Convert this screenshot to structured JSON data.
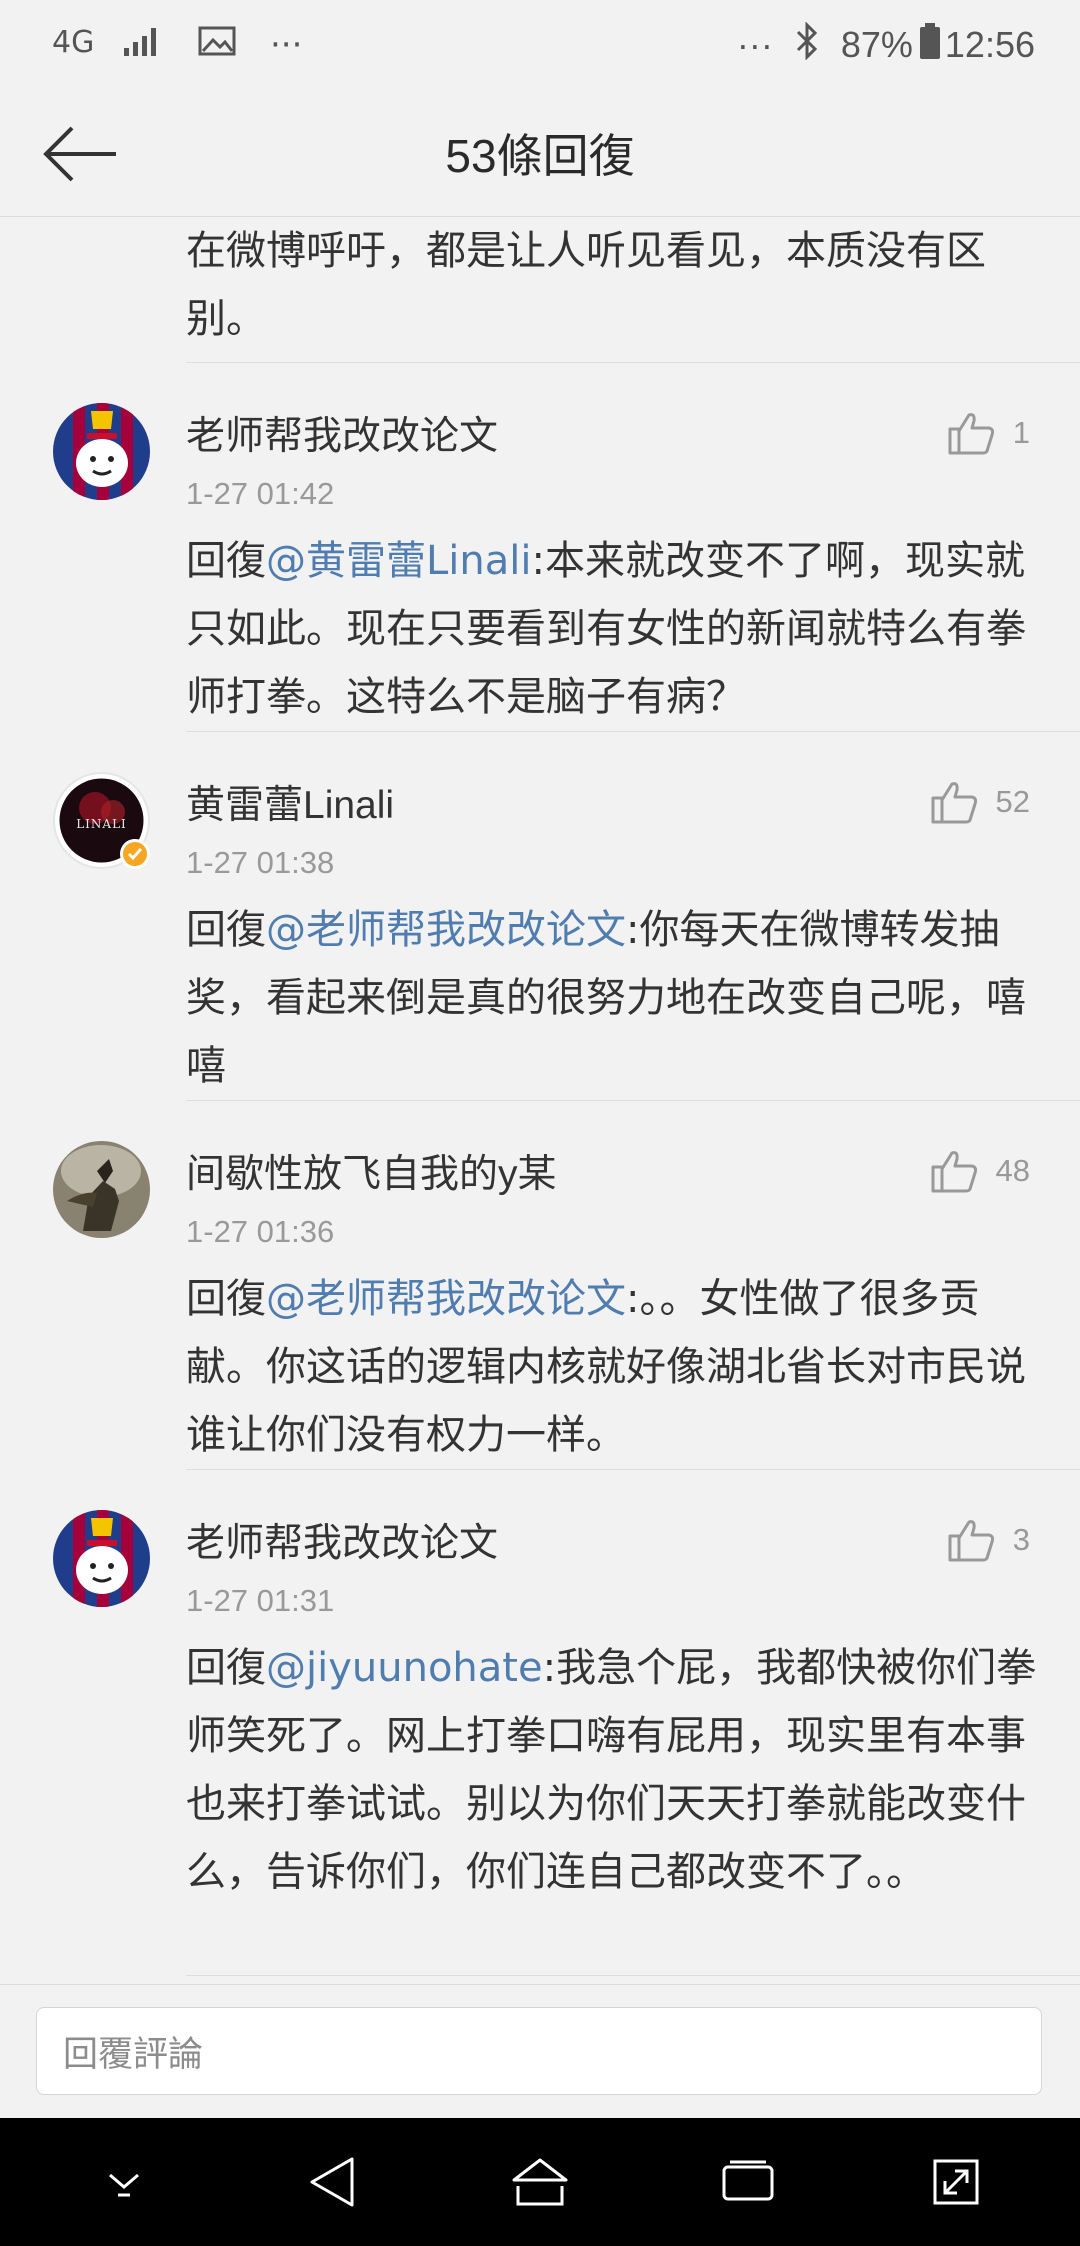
{
  "status_bar": {
    "network_label": "4G",
    "signal_icon": "signal-bars-icon",
    "image_icon": "image-icon",
    "more_icon": "ellipsis-icon",
    "more_dots": "···",
    "right_more": "···",
    "bluetooth_icon": "bluetooth-icon",
    "battery_percent": "87%",
    "battery_icon": "battery-icon",
    "time": "12:56"
  },
  "header": {
    "back_icon": "back-arrow-icon",
    "title": "53條回復"
  },
  "top_fragment": {
    "text": "在微博呼吁，都是让人听见看见，本质没有区别。"
  },
  "comments": [
    {
      "username": "老师帮我改改论文",
      "timestamp": "1-27 01:42",
      "likes": "1",
      "reply_prefix": "回復",
      "mention": "@黄雷蕾Linali",
      "text": ":本来就改变不了啊，现实就只如此。现在只要看到有女性的新闻就特么有拳师打拳。这特么不是脑子有病？",
      "avatar": "fc-barcelona-avatar"
    },
    {
      "username": "黄雷蕾Linali",
      "timestamp": "1-27 01:38",
      "likes": "52",
      "reply_prefix": "回復",
      "mention": "@老师帮我改改论文",
      "text": ":你每天在微博转发抽奖，看起来倒是真的很努力地在改变自己呢，嘻嘻",
      "avatar": "linali-avatar",
      "avatar_text": "LINALI",
      "verified": true
    },
    {
      "username": "间歇性放飞自我的y某",
      "timestamp": "1-27 01:36",
      "likes": "48",
      "reply_prefix": "回復",
      "mention": "@老师帮我改改论文",
      "text": ":。。女性做了很多贡献。你这话的逻辑内核就好像湖北省长对市民说谁让你们没有权力一样。",
      "avatar": "rider-avatar"
    },
    {
      "username": "老师帮我改改论文",
      "timestamp": "1-27 01:31",
      "likes": "3",
      "reply_prefix": "回復",
      "mention": "@jiyuunohate",
      "text": ":我急个屁，我都快被你们拳师笑死了。网上打拳口嗨有屁用，现实里有本事也来打拳试试。别以为你们天天打拳就能改变什么，告诉你们，你们连自己都改变不了。。",
      "avatar": "fc-barcelona-avatar"
    }
  ],
  "reply_bar": {
    "placeholder": "回覆評論"
  },
  "system_nav": {
    "buttons": [
      "hide-keyboard-icon",
      "back-triangle-icon",
      "home-icon",
      "recents-icon",
      "expand-icon"
    ]
  },
  "colors": {
    "mention": "#507daf",
    "background": "#f2f2f2",
    "verified_badge": "#f5a623"
  }
}
